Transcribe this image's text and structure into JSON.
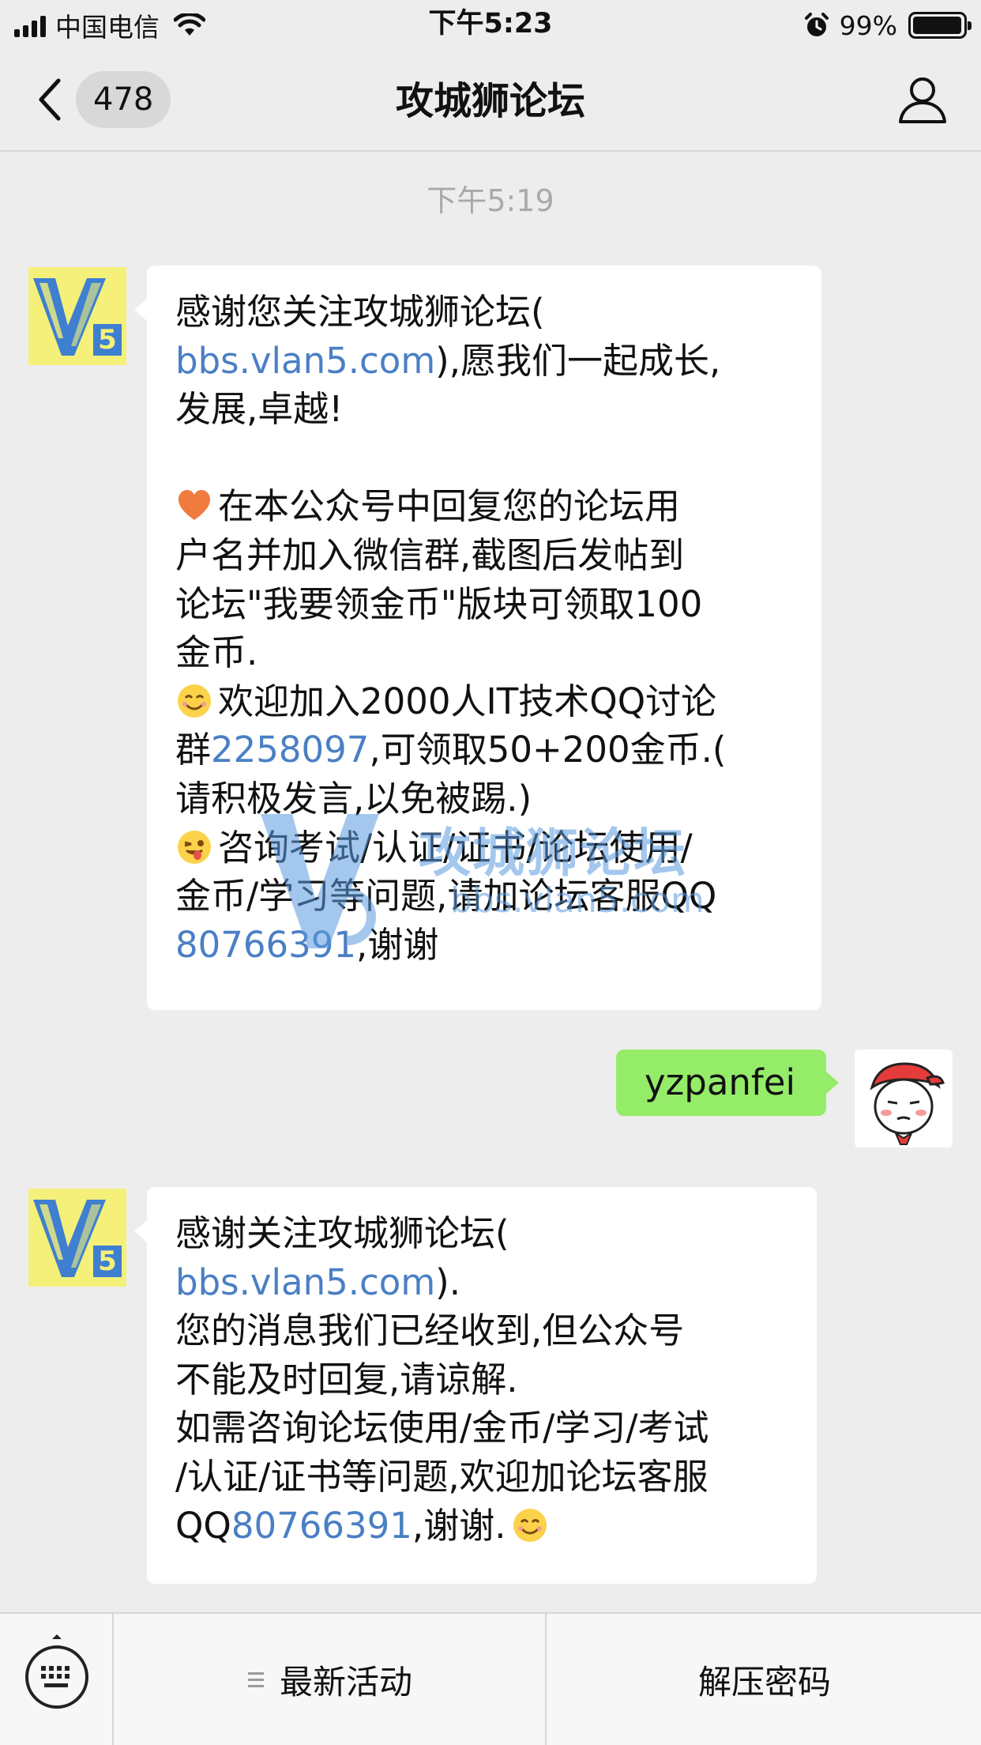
{
  "status_bar": {
    "carrier": "中国电信",
    "time": "下午5:23",
    "battery_percent": "99%",
    "battery_level": 0.99
  },
  "nav": {
    "unread_count": "478",
    "title": "攻城狮论坛"
  },
  "chat": {
    "timestamp": "下午5:19",
    "messages": [
      {
        "sender": "official",
        "lines": [
          "感谢您关注攻城狮论坛(",
          [
            "bbs.vlan5.com",
            "),愿我们一起成长,"
          ],
          "发展,卓越!",
          "",
          [
            "在本公众号中回复您的论坛用"
          ],
          "户名并加入微信群,截图后发帖到",
          "论坛\"我要领金币\"版块可领取100",
          "金币.",
          [
            "欢迎加入2000人IT技术QQ讨论"
          ],
          [
            "群",
            "2258097",
            ",可领取50+200金币.("
          ],
          "请积极发言,以免被踢.)",
          [
            "咨询考试/认证/证书/论坛使用/"
          ],
          "金币/学习等问题,请加论坛客服QQ",
          [
            "80766391",
            ",谢谢"
          ]
        ]
      },
      {
        "sender": "user",
        "text": "yzpanfei"
      },
      {
        "sender": "official",
        "lines": [
          "感谢关注攻城狮论坛(",
          [
            "bbs.vlan5.com",
            ")."
          ],
          "您的消息我们已经收到,但公众号",
          "不能及时回复,请谅解.",
          "如需咨询论坛使用/金币/学习/考试",
          "/认证/证书等问题,欢迎加论坛客服",
          [
            "QQ",
            "80766391",
            ",谢谢."
          ]
        ]
      }
    ],
    "watermark": {
      "text": "攻城狮论坛",
      "url": "bbs.vlan5.com"
    },
    "avatar_text": "V5"
  },
  "bottom_menu": {
    "items": [
      "最新活动",
      "解压密码"
    ]
  },
  "colors": {
    "background": "#ededed",
    "link": "#4a7fc4",
    "user_bubble": "#95ec69",
    "avatar_bg": "#f4f07a"
  }
}
